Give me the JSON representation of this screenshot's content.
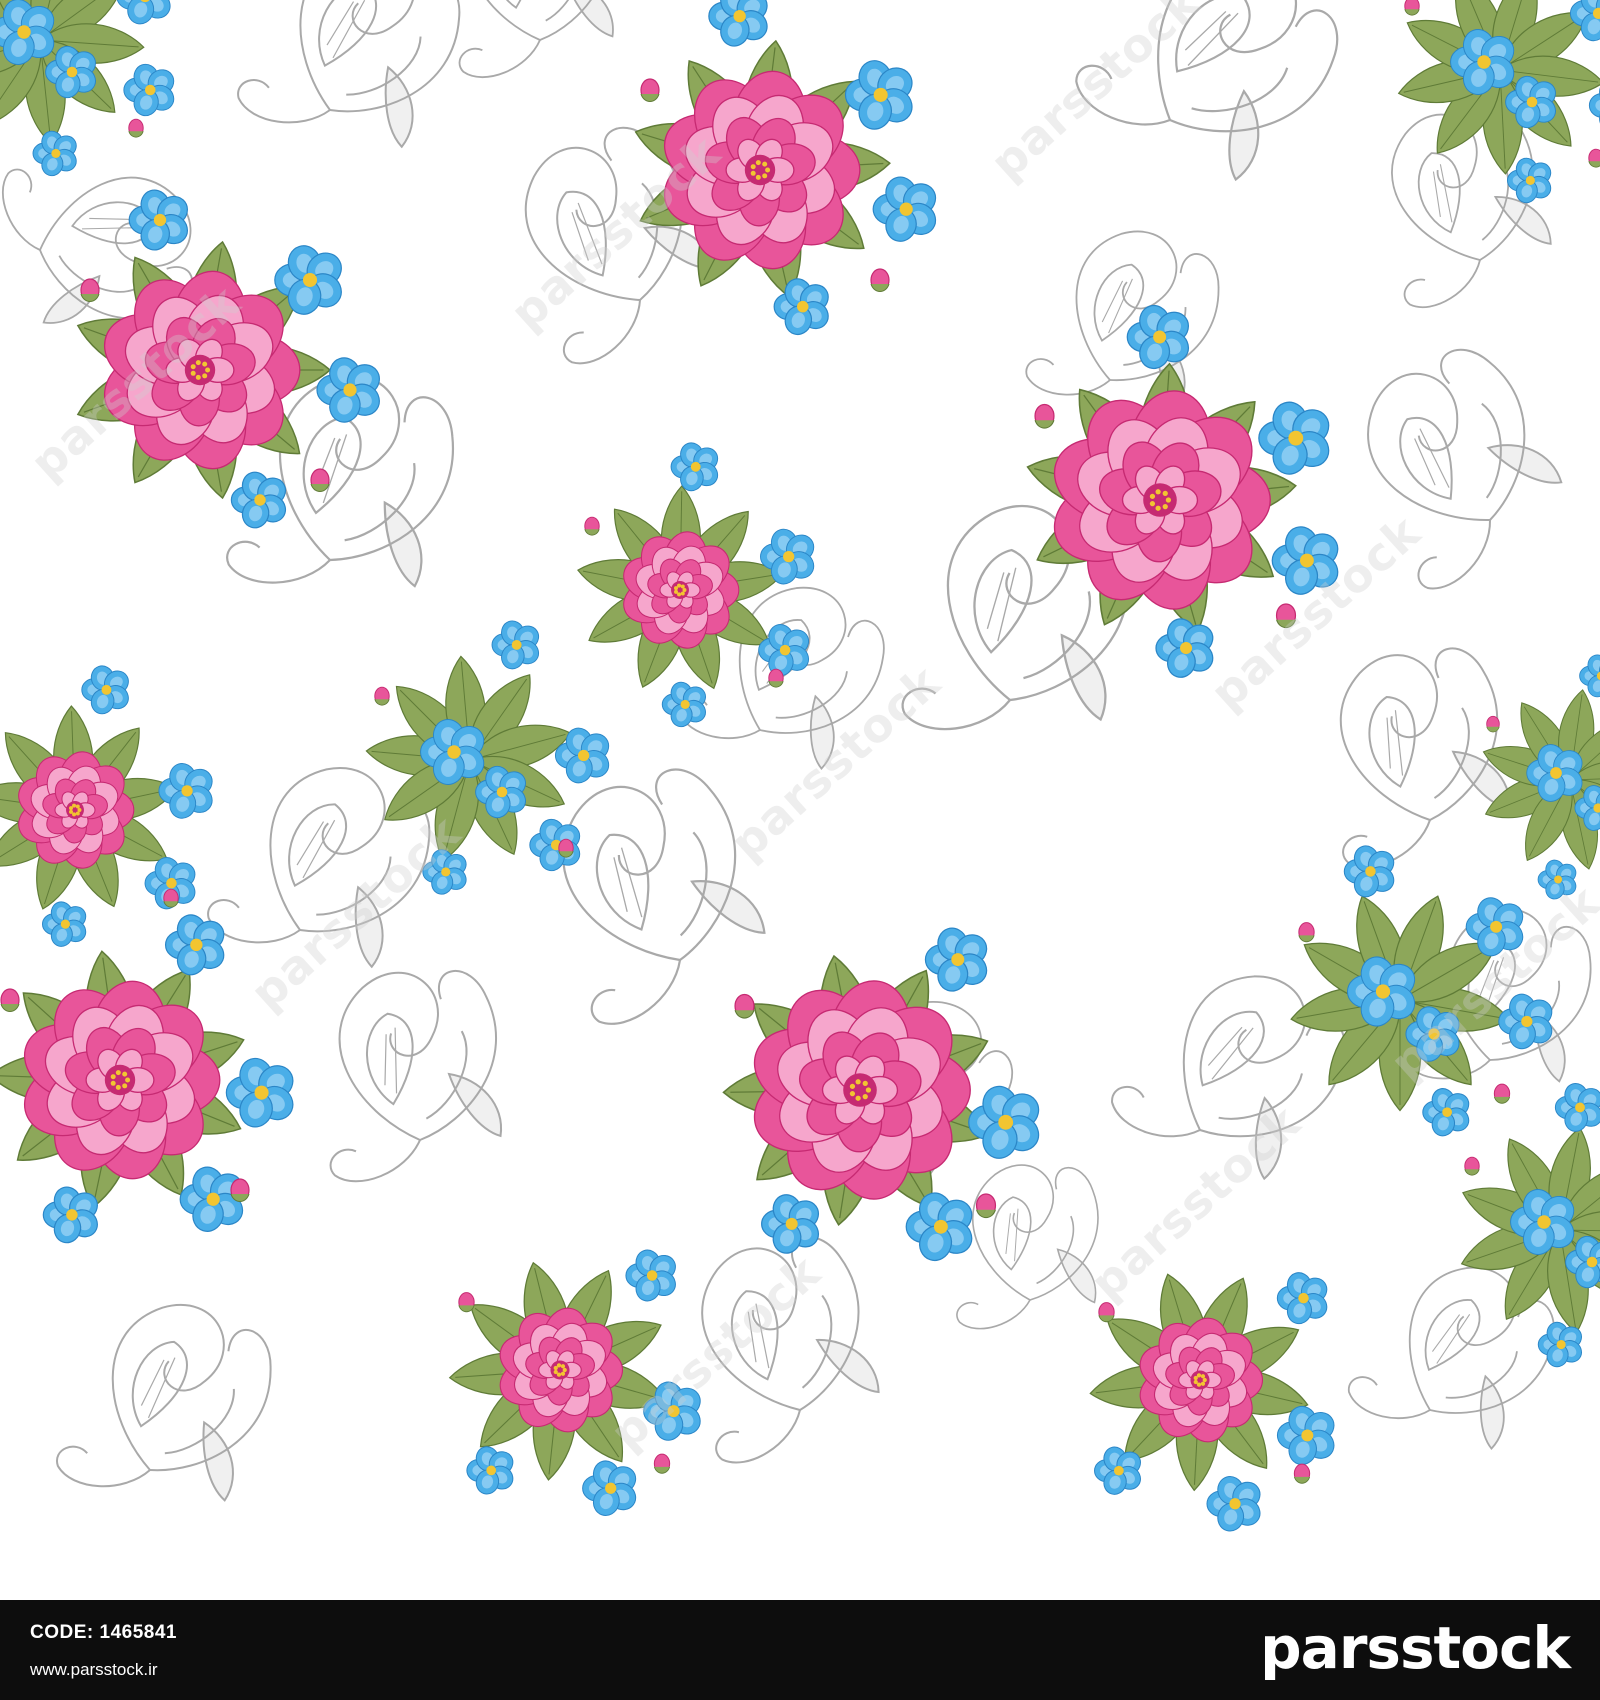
{
  "image": {
    "description_kind": "seamless floral pattern",
    "colors": {
      "background": "#ffffff",
      "rose_pink": "#e8559a",
      "rose_deep": "#c62a72",
      "rose_light": "#f6a6cc",
      "forget_me_not_blue": "#4aaee8",
      "blue_light": "#9fd6f7",
      "flower_center": "#f2c531",
      "leaf_green": "#8da75a",
      "leaf_dark": "#5f7b37",
      "paisley_outline": "#a9a9a9",
      "footer_bg": "#0d0d0d"
    }
  },
  "watermark": {
    "text": "parsstock"
  },
  "footer": {
    "code_label": "CODE:",
    "code_value": "1465841",
    "url": "www.parsstock.ir",
    "brand": "parsstock"
  }
}
